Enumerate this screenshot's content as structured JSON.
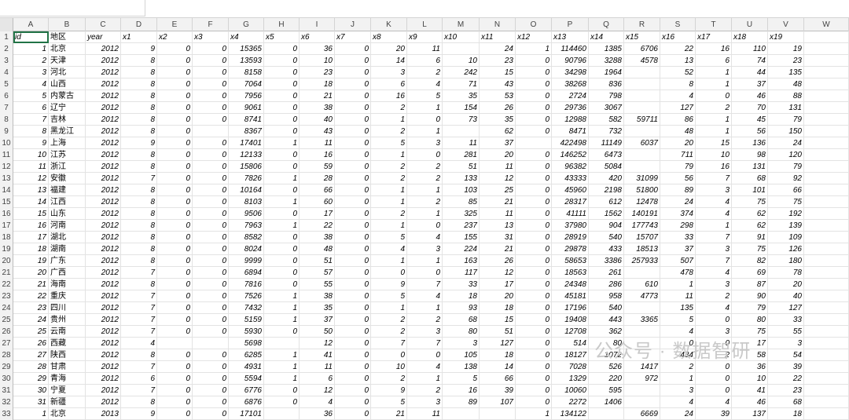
{
  "columns": [
    "A",
    "B",
    "C",
    "D",
    "E",
    "F",
    "G",
    "H",
    "I",
    "J",
    "K",
    "L",
    "M",
    "N",
    "O",
    "P",
    "Q",
    "R",
    "S",
    "T",
    "U",
    "V",
    "W"
  ],
  "header_row": [
    "id",
    "地区",
    "year",
    "x1",
    "x2",
    "x3",
    "x4",
    "x5",
    "x6",
    "x7",
    "x8",
    "x9",
    "x10",
    "x11",
    "x12",
    "x13",
    "x14",
    "x15",
    "x16",
    "x17",
    "x18",
    "x19",
    ""
  ],
  "rows": [
    [
      "1",
      "北京",
      "2012",
      "9",
      "0",
      "0",
      "15365",
      "0",
      "36",
      "0",
      "20",
      "11",
      "",
      "24",
      "1",
      "114460",
      "1385",
      "6706",
      "22",
      "16",
      "110",
      "19"
    ],
    [
      "2",
      "天津",
      "2012",
      "8",
      "0",
      "0",
      "13593",
      "0",
      "10",
      "0",
      "14",
      "6",
      "10",
      "23",
      "0",
      "90796",
      "3288",
      "4578",
      "13",
      "6",
      "74",
      "23"
    ],
    [
      "3",
      "河北",
      "2012",
      "8",
      "0",
      "0",
      "8158",
      "0",
      "23",
      "0",
      "3",
      "2",
      "242",
      "15",
      "0",
      "34298",
      "1964",
      "",
      "52",
      "1",
      "44",
      "135"
    ],
    [
      "4",
      "山西",
      "2012",
      "8",
      "0",
      "0",
      "7064",
      "0",
      "18",
      "0",
      "6",
      "4",
      "71",
      "43",
      "0",
      "38268",
      "836",
      "",
      "8",
      "1",
      "37",
      "48"
    ],
    [
      "5",
      "内蒙古",
      "2012",
      "8",
      "0",
      "0",
      "7956",
      "0",
      "21",
      "0",
      "16",
      "5",
      "35",
      "53",
      "0",
      "2724",
      "798",
      "",
      "4",
      "0",
      "46",
      "88"
    ],
    [
      "6",
      "辽宁",
      "2012",
      "8",
      "0",
      "0",
      "9061",
      "0",
      "38",
      "0",
      "2",
      "1",
      "154",
      "26",
      "0",
      "29736",
      "3067",
      "",
      "127",
      "2",
      "70",
      "131"
    ],
    [
      "7",
      "吉林",
      "2012",
      "8",
      "0",
      "0",
      "8741",
      "0",
      "40",
      "0",
      "1",
      "0",
      "73",
      "35",
      "0",
      "12988",
      "582",
      "59711",
      "86",
      "1",
      "45",
      "79"
    ],
    [
      "8",
      "黑龙江",
      "2012",
      "8",
      "0",
      "",
      "8367",
      "0",
      "43",
      "0",
      "2",
      "1",
      "",
      "62",
      "0",
      "8471",
      "732",
      "",
      "48",
      "1",
      "56",
      "150"
    ],
    [
      "9",
      "上海",
      "2012",
      "9",
      "0",
      "0",
      "17401",
      "1",
      "11",
      "0",
      "5",
      "3",
      "11",
      "37",
      "",
      "422498",
      "11149",
      "6037",
      "20",
      "15",
      "136",
      "24"
    ],
    [
      "10",
      "江苏",
      "2012",
      "8",
      "0",
      "0",
      "12133",
      "0",
      "16",
      "0",
      "1",
      "0",
      "281",
      "20",
      "0",
      "146252",
      "6473",
      "",
      "711",
      "10",
      "98",
      "120"
    ],
    [
      "11",
      "浙江",
      "2012",
      "8",
      "0",
      "0",
      "15806",
      "0",
      "59",
      "0",
      "2",
      "2",
      "51",
      "11",
      "0",
      "96382",
      "5084",
      "",
      "79",
      "16",
      "131",
      "79"
    ],
    [
      "12",
      "安徽",
      "2012",
      "7",
      "0",
      "0",
      "7826",
      "1",
      "28",
      "0",
      "2",
      "2",
      "133",
      "12",
      "0",
      "43333",
      "420",
      "31099",
      "56",
      "7",
      "68",
      "92"
    ],
    [
      "13",
      "福建",
      "2012",
      "8",
      "0",
      "0",
      "10164",
      "0",
      "66",
      "0",
      "1",
      "1",
      "103",
      "25",
      "0",
      "45960",
      "2198",
      "51800",
      "89",
      "3",
      "101",
      "66"
    ],
    [
      "14",
      "江西",
      "2012",
      "8",
      "0",
      "0",
      "8103",
      "1",
      "60",
      "0",
      "1",
      "2",
      "85",
      "21",
      "0",
      "28317",
      "612",
      "12478",
      "24",
      "4",
      "75",
      "75"
    ],
    [
      "15",
      "山东",
      "2012",
      "8",
      "0",
      "0",
      "9506",
      "0",
      "17",
      "0",
      "2",
      "1",
      "325",
      "11",
      "0",
      "41111",
      "1562",
      "140191",
      "374",
      "4",
      "62",
      "192"
    ],
    [
      "16",
      "河南",
      "2012",
      "8",
      "0",
      "0",
      "7963",
      "1",
      "22",
      "0",
      "1",
      "0",
      "237",
      "13",
      "0",
      "37980",
      "904",
      "177743",
      "298",
      "1",
      "62",
      "139"
    ],
    [
      "17",
      "湖北",
      "2012",
      "8",
      "0",
      "0",
      "8582",
      "0",
      "38",
      "0",
      "5",
      "4",
      "155",
      "31",
      "0",
      "28919",
      "540",
      "15707",
      "33",
      "7",
      "91",
      "109"
    ],
    [
      "18",
      "湖南",
      "2012",
      "8",
      "0",
      "0",
      "8024",
      "0",
      "48",
      "0",
      "4",
      "3",
      "224",
      "21",
      "0",
      "29878",
      "433",
      "18513",
      "37",
      "3",
      "75",
      "126"
    ],
    [
      "19",
      "广东",
      "2012",
      "8",
      "0",
      "0",
      "9999",
      "0",
      "51",
      "0",
      "1",
      "1",
      "163",
      "26",
      "0",
      "58653",
      "3386",
      "257933",
      "507",
      "7",
      "82",
      "180"
    ],
    [
      "20",
      "广西",
      "2012",
      "7",
      "0",
      "0",
      "6894",
      "0",
      "57",
      "0",
      "0",
      "0",
      "117",
      "12",
      "0",
      "18563",
      "261",
      "",
      "478",
      "4",
      "69",
      "78"
    ],
    [
      "21",
      "海南",
      "2012",
      "8",
      "0",
      "0",
      "7816",
      "0",
      "55",
      "0",
      "9",
      "7",
      "33",
      "17",
      "0",
      "24348",
      "286",
      "610",
      "1",
      "3",
      "87",
      "20"
    ],
    [
      "22",
      "重庆",
      "2012",
      "7",
      "0",
      "0",
      "7526",
      "1",
      "38",
      "0",
      "5",
      "4",
      "18",
      "20",
      "0",
      "45181",
      "958",
      "4773",
      "11",
      "2",
      "90",
      "40"
    ],
    [
      "23",
      "四川",
      "2012",
      "7",
      "0",
      "0",
      "7432",
      "1",
      "35",
      "0",
      "1",
      "1",
      "93",
      "18",
      "0",
      "17196",
      "540",
      "",
      "135",
      "4",
      "79",
      "127"
    ],
    [
      "24",
      "贵州",
      "2012",
      "7",
      "0",
      "0",
      "5159",
      "1",
      "37",
      "0",
      "2",
      "2",
      "68",
      "15",
      "0",
      "19408",
      "443",
      "3365",
      "5",
      "0",
      "80",
      "33"
    ],
    [
      "25",
      "云南",
      "2012",
      "7",
      "0",
      "0",
      "5930",
      "0",
      "50",
      "0",
      "2",
      "3",
      "80",
      "51",
      "0",
      "12708",
      "362",
      "",
      "4",
      "3",
      "75",
      "55"
    ],
    [
      "26",
      "西藏",
      "2012",
      "4",
      "",
      "",
      "5698",
      "",
      "12",
      "0",
      "7",
      "7",
      "3",
      "127",
      "0",
      "514",
      "80",
      "",
      "0",
      "0",
      "17",
      "3"
    ],
    [
      "27",
      "陕西",
      "2012",
      "8",
      "0",
      "0",
      "6285",
      "1",
      "41",
      "0",
      "0",
      "0",
      "105",
      "18",
      "0",
      "18127",
      "1072",
      "",
      "434",
      "2",
      "58",
      "54"
    ],
    [
      "28",
      "甘肃",
      "2012",
      "7",
      "0",
      "0",
      "4931",
      "1",
      "11",
      "0",
      "10",
      "4",
      "138",
      "14",
      "0",
      "7028",
      "526",
      "1417",
      "2",
      "0",
      "36",
      "39"
    ],
    [
      "29",
      "青海",
      "2012",
      "6",
      "0",
      "0",
      "5594",
      "1",
      "6",
      "0",
      "2",
      "1",
      "5",
      "66",
      "0",
      "1329",
      "220",
      "972",
      "1",
      "0",
      "10",
      "22"
    ],
    [
      "30",
      "宁夏",
      "2012",
      "7",
      "0",
      "0",
      "6776",
      "0",
      "12",
      "0",
      "9",
      "2",
      "16",
      "39",
      "0",
      "10060",
      "595",
      "",
      "3",
      "0",
      "41",
      "23"
    ],
    [
      "31",
      "新疆",
      "2012",
      "8",
      "0",
      "0",
      "6876",
      "0",
      "4",
      "0",
      "5",
      "3",
      "89",
      "107",
      "0",
      "2272",
      "1406",
      "",
      "4",
      "4",
      "46",
      "68"
    ],
    [
      "1",
      "北京",
      "2013",
      "9",
      "0",
      "0",
      "17101",
      "",
      "36",
      "0",
      "21",
      "11",
      "",
      "",
      "1",
      "134122",
      "",
      "6669",
      "24",
      "39",
      "137",
      "18"
    ]
  ],
  "watermark": "公众号 · 数据智研"
}
